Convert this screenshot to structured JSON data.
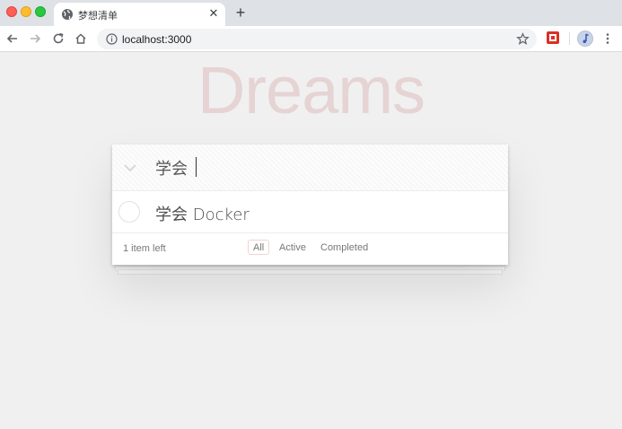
{
  "browser": {
    "tab_title": "梦想清单",
    "url": "localhost:3000"
  },
  "app": {
    "title": "Dreams",
    "new_todo_value": "学会",
    "todos": [
      {
        "label": "学会 Docker",
        "completed": false
      }
    ],
    "footer": {
      "count_text": "1 item left",
      "filters": [
        "All",
        "Active",
        "Completed"
      ],
      "selected_filter": "All"
    }
  },
  "colors": {
    "title_color": "rgba(175,47,47,0.15)",
    "accent_border": "rgba(175,47,47,0.2)"
  }
}
